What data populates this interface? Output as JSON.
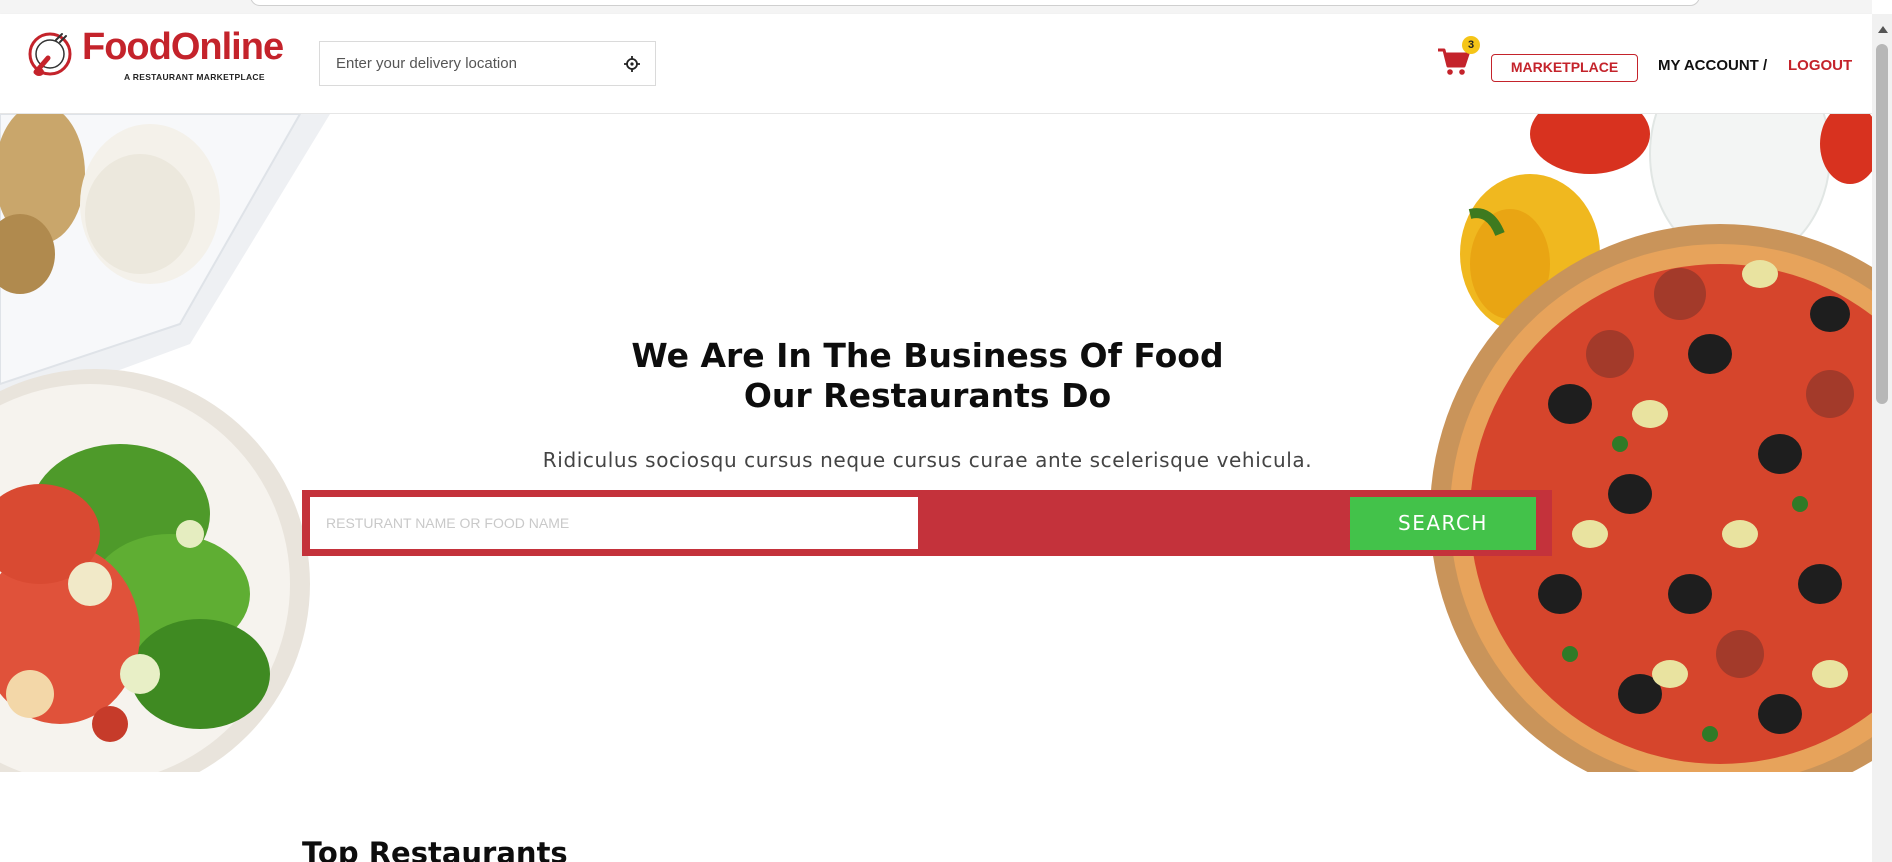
{
  "brand": {
    "name": "FoodOnline",
    "tagline": "A RESTAURANT MARKETPLACE",
    "color": "#c4232b"
  },
  "header": {
    "location_placeholder": "Enter your delivery location",
    "location_icon": "crosshair-icon",
    "cart_icon": "shopping-cart-icon",
    "cart_count": "3",
    "marketplace_label": "MARKETPLACE",
    "account_label": "MY ACCOUNT /",
    "logout_label": "LOGOUT"
  },
  "hero": {
    "title_line1": "We Are In The Business Of Food",
    "title_line2": "Our Restaurants Do",
    "subtitle": "Ridiculus sociosqu cursus neque cursus curae ante scelerisque vehicula.",
    "search_placeholder": "RESTURANT NAME OR FOOD NAME",
    "search_button": "SEARCH",
    "search_bar_color": "#c4323b",
    "search_button_color": "#43c24a"
  },
  "section": {
    "top_restaurants_title": "Top Restaurants"
  }
}
